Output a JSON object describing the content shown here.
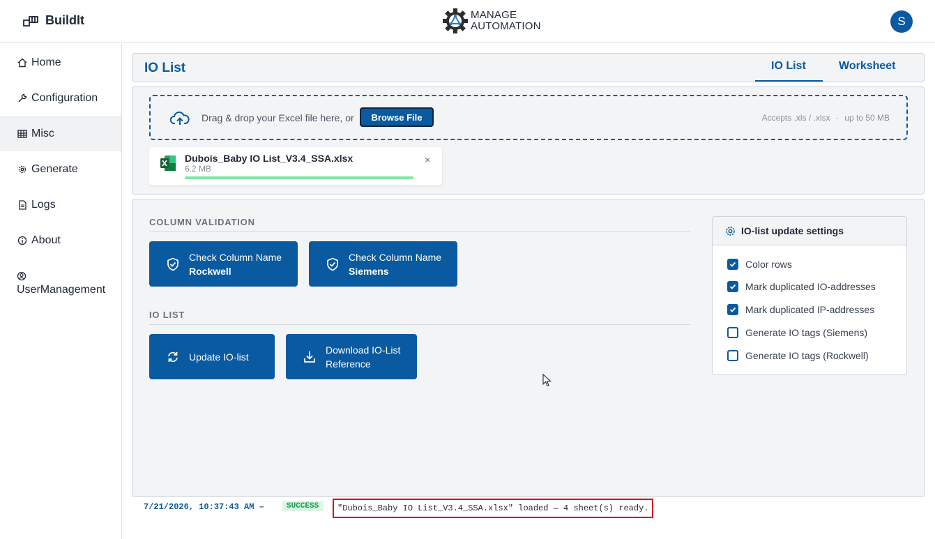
{
  "app": {
    "name": "BuildIt",
    "user_initial": "S"
  },
  "logo": {
    "line1": "MANAGE",
    "line2": "AUTOMATION"
  },
  "sidebar": {
    "items": [
      {
        "label": "Home",
        "icon": "home-icon"
      },
      {
        "label": "Configuration",
        "icon": "wrench-icon"
      },
      {
        "label": "Misc",
        "icon": "table-icon",
        "active": true
      },
      {
        "label": "Generate",
        "icon": "gear-icon"
      },
      {
        "label": "Logs",
        "icon": "document-icon"
      },
      {
        "label": "About",
        "icon": "info-icon"
      },
      {
        "label": "UserManagement",
        "icon": "user-circle-icon"
      }
    ]
  },
  "page": {
    "title": "IO List",
    "tabs": [
      {
        "label": "IO List",
        "active": true
      },
      {
        "label": "Worksheet",
        "active": false
      }
    ]
  },
  "upload": {
    "drop_text": "Drag & drop your Excel file here, or",
    "browse_label": "Browse File",
    "accepts": "Accepts .xls / .xlsx",
    "separator": "·",
    "max_size": "up to 50 MB",
    "file": {
      "name": "Dubois_Baby IO List_V3.4_SSA.xlsx",
      "size": "6.2 MB",
      "progress": 1.0,
      "close": "×"
    }
  },
  "column_validation": {
    "heading": "COLUMN VALIDATION",
    "buttons": [
      {
        "line1": "Check Column Name",
        "line2": "Rockwell"
      },
      {
        "line1": "Check Column Name",
        "line2": "Siemens"
      }
    ]
  },
  "io_list": {
    "heading": "IO LIST",
    "update_label": "Update IO-list",
    "download_line1": "Download IO-List",
    "download_line2": "Reference"
  },
  "settings": {
    "title": "IO-list update settings",
    "options": [
      {
        "label": "Color rows",
        "checked": true
      },
      {
        "label": "Mark duplicated IO-addresses",
        "checked": true
      },
      {
        "label": "Mark duplicated IP-addresses",
        "checked": true
      },
      {
        "label": "Generate IO tags (Siemens)",
        "checked": false
      },
      {
        "label": "Generate IO tags (Rockwell)",
        "checked": false
      }
    ]
  },
  "status": {
    "timestamp": "7/21/2026, 10:37:43 AM –",
    "badge": "SUCCESS",
    "message": "\"Dubois_Baby IO List_V3.4_SSA.xlsx\" loaded — 4 sheet(s) ready."
  },
  "colors": {
    "primary": "#0a5aa1",
    "success_bg": "#d9f5e3",
    "success_text": "#159a4a",
    "progress": "#7ee8a2",
    "highlight": "#d0131a"
  }
}
